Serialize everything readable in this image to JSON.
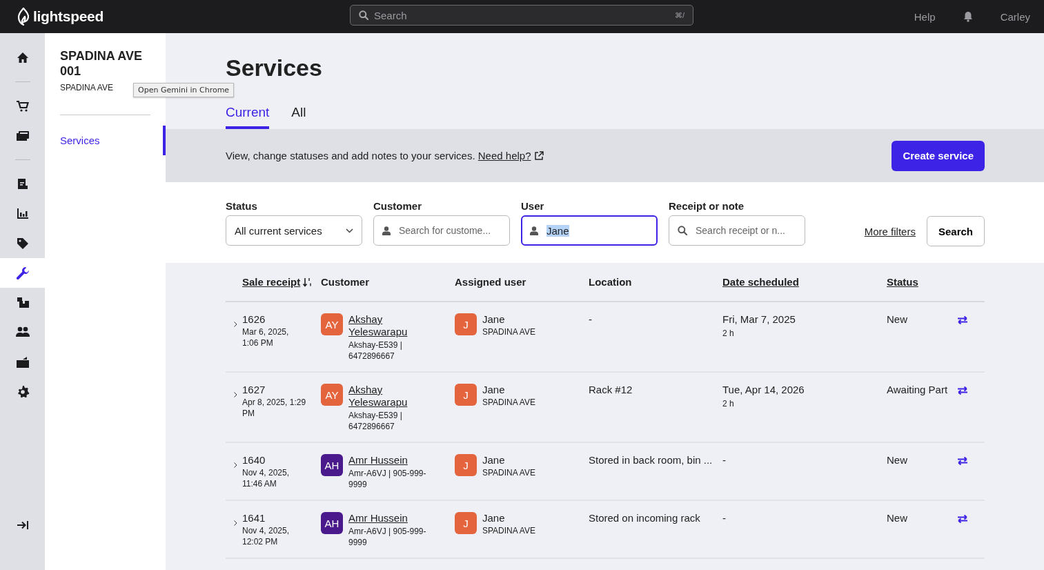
{
  "topbar": {
    "logo": "lightspeed",
    "search": {
      "placeholder": "Search",
      "shortcut": "⌘/"
    },
    "help": "Help",
    "user": "Carley"
  },
  "rail": {
    "groups": [
      {
        "items": [
          {
            "selected": false
          }
        ]
      },
      {
        "items": [
          {
            "selected": false
          },
          {
            "selected": false
          }
        ]
      },
      {
        "items": [
          {
            "selected": false
          },
          {
            "selected": false
          },
          {
            "selected": false
          },
          {
            "selected": true
          },
          {
            "selected": false
          },
          {
            "selected": false
          },
          {
            "selected": false
          },
          {
            "selected": false
          }
        ]
      }
    ]
  },
  "subnav": {
    "title": "SPADINA AVE 001",
    "subtitle": "SPADINA AVE",
    "items": [
      {
        "label": "Services",
        "selected": true
      }
    ]
  },
  "tooltip": "Open Gemini in Chrome",
  "page": {
    "title": "Services",
    "tabs": [
      {
        "label": "Current",
        "selected": true
      },
      {
        "label": "All",
        "selected": false
      }
    ]
  },
  "banner": {
    "text": "View, change statuses and add notes to your services. ",
    "link": "Need help?",
    "button": "Create service"
  },
  "filters": [
    {
      "kind": "select",
      "label": "Status",
      "value": "All current services"
    },
    {
      "kind": "person",
      "label": "Customer",
      "placeholder": "Search for custome...",
      "focused": false
    },
    {
      "kind": "person",
      "label": "User",
      "value": "Jane",
      "focused": true
    },
    {
      "kind": "search",
      "label": "Receipt or note",
      "placeholder": "Search receipt or n...",
      "focused": false
    }
  ],
  "more_filters": "More filters",
  "search_button": "Search",
  "table": {
    "columns": [
      {
        "label": "Sale receipt",
        "sortable": true,
        "sorted": true
      },
      {
        "label": "Customer",
        "sortable": false,
        "sorted": false
      },
      {
        "label": "Assigned user",
        "sortable": false,
        "sorted": false
      },
      {
        "label": "Location",
        "sortable": false,
        "sorted": false
      },
      {
        "label": "Date scheduled",
        "sortable": true,
        "sorted": false
      },
      {
        "label": "Status",
        "sortable": true,
        "sorted": false
      }
    ],
    "rows": [
      {
        "receipt": "1626",
        "receipt_date": "Mar 6, 2025, 1:06 PM",
        "customer": {
          "initials": "AY",
          "color": "#e4643e",
          "name": "Akshay Yeleswarapu",
          "detail": "Akshay-E539 | 6472896667"
        },
        "user": {
          "initials": "J",
          "color": "#e4643e",
          "name": "Jane",
          "location": "SPADINA AVE"
        },
        "location": "-",
        "date": "Fri, Mar 7, 2025",
        "duration": "2 h",
        "status": "New"
      },
      {
        "receipt": "1627",
        "receipt_date": "Apr 8, 2025, 1:29 PM",
        "customer": {
          "initials": "AY",
          "color": "#e4643e",
          "name": "Akshay Yeleswarapu",
          "detail": "Akshay-E539 | 6472896667"
        },
        "user": {
          "initials": "J",
          "color": "#e4643e",
          "name": "Jane",
          "location": "SPADINA AVE"
        },
        "location": "Rack #12",
        "date": "Tue, Apr 14, 2026",
        "duration": "2 h",
        "status": "Awaiting Part"
      },
      {
        "receipt": "1640",
        "receipt_date": "Nov 4, 2025, 11:46 AM",
        "customer": {
          "initials": "AH",
          "color": "#4a1a8c",
          "name": "Amr Hussein",
          "detail": "Amr-A6VJ | 905-999-9999"
        },
        "user": {
          "initials": "J",
          "color": "#e4643e",
          "name": "Jane",
          "location": "SPADINA AVE"
        },
        "location": "Stored in back room, bin ...",
        "date": "-",
        "status": "New"
      },
      {
        "receipt": "1641",
        "receipt_date": "Nov 4, 2025, 12:02 PM",
        "customer": {
          "initials": "AH",
          "color": "#4a1a8c",
          "name": "Amr Hussein",
          "detail": "Amr-A6VJ | 905-999-9999"
        },
        "user": {
          "initials": "J",
          "color": "#e4643e",
          "name": "Jane",
          "location": "SPADINA AVE"
        },
        "location": "Stored on incoming rack",
        "date": "-",
        "status": "New"
      }
    ]
  }
}
